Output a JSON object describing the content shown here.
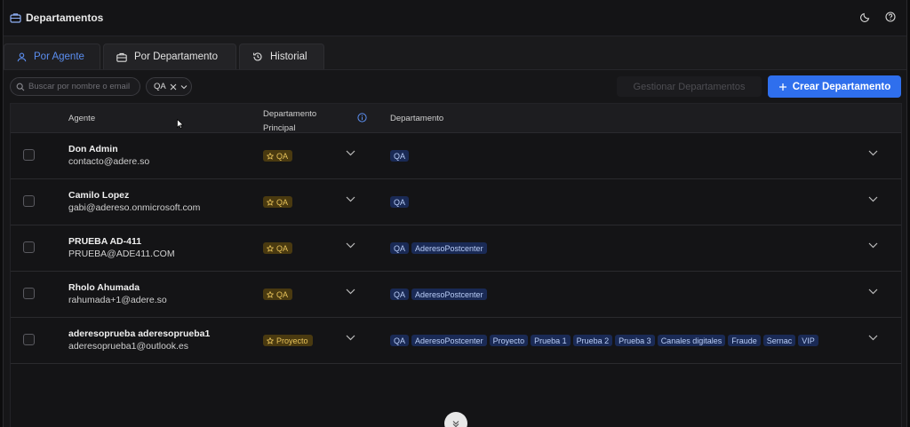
{
  "app": {
    "title": "Departamentos"
  },
  "tabs": [
    {
      "label": "Por Agente"
    },
    {
      "label": "Por Departamento"
    },
    {
      "label": "Historial"
    }
  ],
  "toolbar": {
    "search_placeholder": "Buscar por nombre o email",
    "filter_value": "QA",
    "manage_label": "Gestionar Departamentos",
    "create_label": "Crear Departamento"
  },
  "table": {
    "headers": {
      "agente": "Agente",
      "dep_principal_line1": "Departamento",
      "dep_principal_line2": "Principal",
      "departamento": "Departamento"
    },
    "rows": [
      {
        "name": "Don Admin",
        "email": "contacto@adere.so",
        "main": "QA",
        "deps": [
          "QA"
        ]
      },
      {
        "name": "Camilo Lopez",
        "email": "gabi@adereso.onmicrosoft.com",
        "main": "QA",
        "deps": [
          "QA"
        ]
      },
      {
        "name": "PRUEBA AD-411",
        "email": "PRUEBA@ADE411.COM",
        "main": "QA",
        "deps": [
          "QA",
          "AderesoPostcenter"
        ]
      },
      {
        "name": "Rholo Ahumada",
        "email": "rahumada+1@adere.so",
        "main": "QA",
        "deps": [
          "QA",
          "AderesoPostcenter"
        ]
      },
      {
        "name": "aderesoprueba aderesoprueba1",
        "email": "aderesoprueba1@outlook.es",
        "main": "Proyecto",
        "deps": [
          "QA",
          "AderesoPostcenter",
          "Proyecto",
          "Prueba 1",
          "Prueba 2",
          "Prueba 3",
          "Canales digitales",
          "Fraude",
          "Sernac",
          "VIP"
        ]
      }
    ]
  },
  "colors": {
    "accent": "#2f6fed",
    "active_tab": "#5b8ef0",
    "main_tag_bg": "#4a3a10",
    "main_tag_fg": "#e7c25a",
    "dep_tag_bg": "#1a2a55",
    "dep_tag_fg": "#b9cdf7"
  },
  "icons": [
    "briefcase-icon",
    "moon-icon",
    "help-icon",
    "user-icon",
    "history-icon",
    "search-icon",
    "close-icon",
    "chevron-down-icon",
    "plus-icon",
    "info-icon",
    "star-icon",
    "mouse-cursor"
  ]
}
